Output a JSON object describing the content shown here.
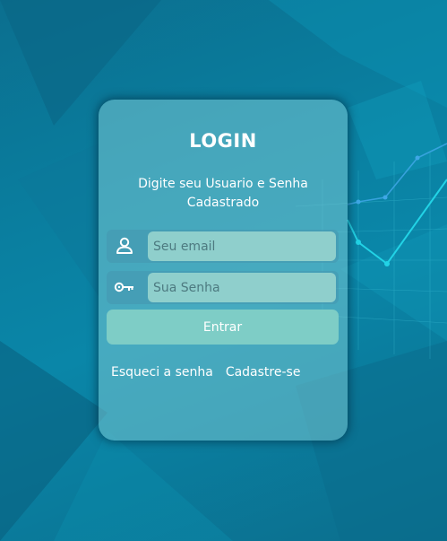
{
  "login": {
    "title": "LOGIN",
    "subtitle": "Digite seu Usuario e Senha Cadastrado",
    "email": {
      "placeholder": "Seu email",
      "value": ""
    },
    "password": {
      "placeholder": "Sua Senha",
      "value": ""
    },
    "submit_label": "Entrar",
    "forgot_label": "Esqueci a senha",
    "signup_label": "Cadastre-se"
  },
  "icons": {
    "email": "user-icon",
    "password": "key-icon"
  },
  "colors": {
    "background": "#0a7fa0",
    "card": "#78c8d4",
    "input": "#8fcfcc",
    "button": "#7ecdc6",
    "accent_lines": "#22d3e6"
  }
}
